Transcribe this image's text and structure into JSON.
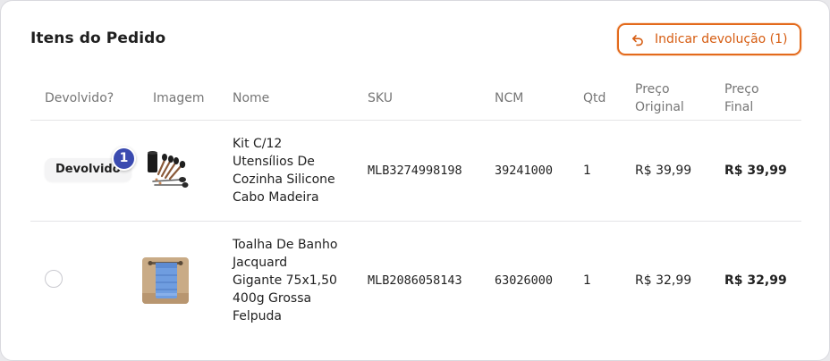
{
  "card": {
    "title": "Itens do Pedido"
  },
  "actions": {
    "return_button_label": "Indicar devolução (1)",
    "return_button_icon": "undo-arrow-icon",
    "accent_color": "#e36a1c"
  },
  "table": {
    "headers": {
      "returned": "Devolvido?",
      "image": "Imagem",
      "name": "Nome",
      "sku": "SKU",
      "ncm": "NCM",
      "qty": "Qtd",
      "orig_price_1": "Preço",
      "orig_price_2": "Original",
      "final_price_1": "Preço",
      "final_price_2": "Final"
    },
    "rows": [
      {
        "returned_label": "Devolvido",
        "returned_count": "1",
        "image": "kitchen-utensil-set-image",
        "name_lines": [
          "Kit C/12",
          "Utensílios De",
          "Cozinha Silicone",
          "Cabo Madeira"
        ],
        "sku": "MLB3274998198",
        "ncm": "39241000",
        "qty": "1",
        "original_price": "R$ 39,99",
        "final_price": "R$ 39,99"
      },
      {
        "returned_checkbox": false,
        "image": "blue-towel-image",
        "name_lines": [
          "Toalha De Banho",
          "Jacquard",
          "Gigante 75x1,50",
          "400g Grossa",
          "Felpuda"
        ],
        "sku": "MLB2086058143",
        "ncm": "63026000",
        "qty": "1",
        "original_price": "R$ 32,99",
        "final_price": "R$ 32,99"
      }
    ]
  }
}
